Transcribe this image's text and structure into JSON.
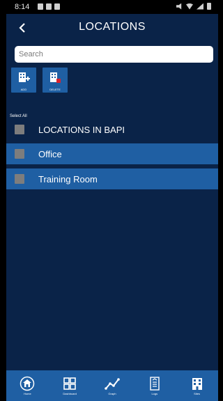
{
  "status_bar": {
    "time": "8:14"
  },
  "header": {
    "title": "LOCATIONS",
    "back_glyph": "<"
  },
  "search": {
    "placeholder": "Search",
    "value": ""
  },
  "actions": {
    "add_label": "ADD",
    "delete_label": "DELETE"
  },
  "list": {
    "select_all_label": "Select All",
    "header_row": "LOCATIONS IN BAPI",
    "items": [
      {
        "label": "Office"
      },
      {
        "label": "Training Room"
      }
    ]
  },
  "bottom_nav": {
    "items": [
      {
        "label": "Home",
        "icon": "home-icon"
      },
      {
        "label": "Dashboard",
        "icon": "dashboard-icon"
      },
      {
        "label": "Graph",
        "icon": "graph-icon"
      },
      {
        "label": "Logs",
        "icon": "logs-icon"
      },
      {
        "label": "Sites",
        "icon": "sites-icon"
      }
    ]
  },
  "colors": {
    "background": "#0a2348",
    "accent": "#1f5fa3",
    "checkbox": "#7d7d7d"
  }
}
